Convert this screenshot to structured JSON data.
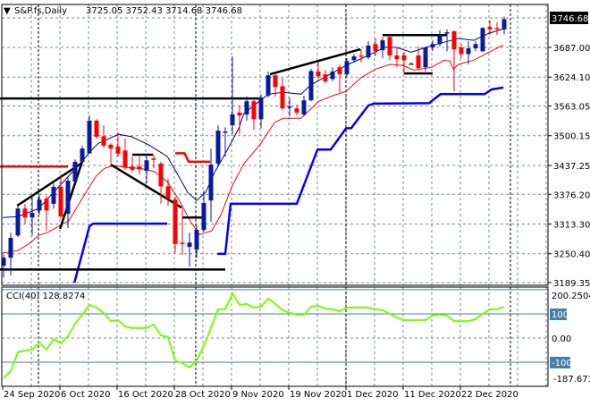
{
  "header": {
    "menu_glyph": "▼",
    "symbol": "S&P.fs,Daily",
    "ohlc": "3725.05 3752.43 3714.68 3746.68"
  },
  "price_axis": {
    "current_price": "3746.68",
    "ticks": [
      "3687.00",
      "3624.10",
      "3563.05",
      "3500.15",
      "3437.25",
      "3376.20",
      "3313.30",
      "3250.40",
      "3189.35"
    ]
  },
  "cci_panel": {
    "title": "CCI(40) 128.8274",
    "max_label": "200.2504",
    "level_up": "100",
    "zero": "0.00",
    "level_down": "-100",
    "min_label": "-187.6739"
  },
  "date_labels": [
    {
      "label": "24 Sep 2020",
      "index": 0
    },
    {
      "label": "6 Oct 2020",
      "index": 8
    },
    {
      "label": "16 Oct 2020",
      "index": 16
    },
    {
      "label": "28 Oct 2020",
      "index": 24
    },
    {
      "label": "9 Nov 2020",
      "index": 32
    },
    {
      "label": "19 Nov 2020",
      "index": 40
    },
    {
      "label": "1 Dec 2020",
      "index": 48
    },
    {
      "label": "11 Dec 2020",
      "index": 56
    },
    {
      "label": "22 Dec 2020",
      "index": 64
    }
  ],
  "colors": {
    "bull": "#0a1a9c",
    "bear": "#ff0000",
    "ma_fast": "#000080",
    "ma_slow": "#ff0000",
    "support": "#0000ff",
    "resistance": "#ff0000",
    "trendlines": "#000000",
    "cci": "#7cfc00",
    "cci_levels": "#4a7eaa"
  },
  "chart_data": {
    "type": "candlestick",
    "title": "S&P.fs,Daily",
    "ylim": [
      3185.6,
      3776
    ],
    "ohlc": [
      [
        3225,
        3248,
        3200,
        3242
      ],
      [
        3242,
        3295,
        3204,
        3284
      ],
      [
        3289,
        3352,
        3286,
        3346
      ],
      [
        3346,
        3356,
        3314,
        3327
      ],
      [
        3327,
        3371,
        3289,
        3337
      ],
      [
        3342,
        3375,
        3333,
        3365
      ],
      [
        3367,
        3373,
        3299,
        3342
      ],
      [
        3356,
        3399,
        3346,
        3392
      ],
      [
        3392,
        3418,
        3325,
        3329
      ],
      [
        3335,
        3412,
        3305,
        3405
      ],
      [
        3403,
        3450,
        3399,
        3445
      ],
      [
        3445,
        3479,
        3441,
        3473
      ],
      [
        3463,
        3543,
        3462,
        3532
      ],
      [
        3532,
        3535,
        3494,
        3498
      ],
      [
        3499,
        3522,
        3475,
        3479
      ],
      [
        3481,
        3484,
        3441,
        3473
      ],
      [
        3477,
        3507,
        3456,
        3462
      ],
      [
        3469,
        3494,
        3428,
        3433
      ],
      [
        3435,
        3456,
        3422,
        3428
      ],
      [
        3435,
        3456,
        3418,
        3429
      ],
      [
        3426,
        3456,
        3399,
        3448
      ],
      [
        3452,
        3460,
        3431,
        3450
      ],
      [
        3441,
        3445,
        3356,
        3393
      ],
      [
        3393,
        3409,
        3352,
        3367
      ],
      [
        3365,
        3371,
        3253,
        3271
      ],
      [
        3274,
        3346,
        3248,
        3272
      ],
      [
        3265,
        3295,
        3223,
        3274
      ],
      [
        3259,
        3310,
        3242,
        3301
      ],
      [
        3301,
        3384,
        3297,
        3358
      ],
      [
        3363,
        3473,
        3318,
        3439
      ],
      [
        3441,
        3522,
        3437,
        3511
      ],
      [
        3507,
        3518,
        3456,
        3509
      ],
      [
        3522,
        3668,
        3503,
        3545
      ],
      [
        3549,
        3564,
        3503,
        3543
      ],
      [
        3545,
        3583,
        3532,
        3573
      ],
      [
        3573,
        3579,
        3513,
        3535
      ],
      [
        3535,
        3588,
        3516,
        3581
      ],
      [
        3585,
        3636,
        3581,
        3628
      ],
      [
        3628,
        3632,
        3583,
        3603
      ],
      [
        3605,
        3622,
        3554,
        3558
      ],
      [
        3560,
        3581,
        3541,
        3562
      ],
      [
        3558,
        3566,
        3543,
        3549
      ],
      [
        3545,
        3585,
        3541,
        3575
      ],
      [
        3575,
        3641,
        3573,
        3637
      ],
      [
        3636,
        3656,
        3620,
        3626
      ],
      [
        3630,
        3639,
        3611,
        3615
      ],
      [
        3620,
        3645,
        3615,
        3636
      ],
      [
        3645,
        3651,
        3592,
        3630
      ],
      [
        3630,
        3664,
        3626,
        3658
      ],
      [
        3660,
        3673,
        3655,
        3668
      ],
      [
        3670,
        3683,
        3655,
        3668
      ],
      [
        3666,
        3700,
        3662,
        3691
      ],
      [
        3694,
        3706,
        3668,
        3679
      ],
      [
        3681,
        3708,
        3664,
        3702
      ],
      [
        3709,
        3713,
        3660,
        3670
      ],
      [
        3670,
        3687,
        3645,
        3662
      ],
      [
        3670,
        3677,
        3630,
        3660
      ],
      [
        3653,
        3655,
        3651,
        3653
      ],
      [
        3670,
        3689,
        3639,
        3643
      ],
      [
        3645,
        3689,
        3636,
        3687
      ],
      [
        3687,
        3702,
        3679,
        3694
      ],
      [
        3694,
        3723,
        3689,
        3713
      ],
      [
        3717,
        3725,
        3679,
        3719
      ],
      [
        3721,
        3723,
        3594,
        3683
      ],
      [
        3687,
        3694,
        3664,
        3673
      ],
      [
        3673,
        3700,
        3651,
        3685
      ],
      [
        3685,
        3700,
        3679,
        3694
      ],
      [
        3679,
        3730,
        3677,
        3728
      ],
      [
        3730,
        3745,
        3713,
        3725
      ],
      [
        3728,
        3740,
        3713,
        3726
      ],
      [
        3725.05,
        3752.43,
        3714.68,
        3746.68
      ]
    ],
    "ma_fast": [
      [
        -0.1,
        3327
      ],
      [
        2,
        3329
      ],
      [
        4.9,
        3346
      ],
      [
        11,
        3446
      ],
      [
        12,
        3465
      ],
      [
        13.25,
        3484
      ],
      [
        16.1,
        3503
      ],
      [
        17.9,
        3498
      ],
      [
        20.4,
        3480
      ],
      [
        22.9,
        3456
      ],
      [
        24.5,
        3414
      ],
      [
        25.75,
        3380
      ],
      [
        27,
        3363
      ],
      [
        28.25,
        3380
      ],
      [
        29.5,
        3422
      ],
      [
        31.1,
        3465
      ],
      [
        32.9,
        3516
      ],
      [
        33.6,
        3547
      ],
      [
        37,
        3588
      ],
      [
        39.1,
        3592
      ],
      [
        41.6,
        3588
      ],
      [
        42.9,
        3607
      ],
      [
        44.9,
        3624
      ],
      [
        47.9,
        3649
      ],
      [
        50.75,
        3668
      ],
      [
        53.25,
        3687
      ],
      [
        54.9,
        3687
      ],
      [
        57,
        3677
      ],
      [
        59.1,
        3687
      ],
      [
        61.6,
        3698
      ],
      [
        63.6,
        3706
      ],
      [
        65.75,
        3702
      ],
      [
        67.9,
        3717
      ],
      [
        69.9,
        3726
      ]
    ],
    "ma_slow": [
      [
        -0.1,
        3252
      ],
      [
        2,
        3257
      ],
      [
        3.6,
        3272
      ],
      [
        4.9,
        3289
      ],
      [
        6.1,
        3295
      ],
      [
        7.9,
        3310
      ],
      [
        9.1,
        3320
      ],
      [
        10.75,
        3361
      ],
      [
        12.9,
        3414
      ],
      [
        14.1,
        3431
      ],
      [
        15.4,
        3437
      ],
      [
        17,
        3433
      ],
      [
        19.1,
        3431
      ],
      [
        21.1,
        3424
      ],
      [
        22.9,
        3403
      ],
      [
        24.5,
        3365
      ],
      [
        26.1,
        3320
      ],
      [
        27.4,
        3291
      ],
      [
        29.1,
        3299
      ],
      [
        30.4,
        3333
      ],
      [
        32,
        3395
      ],
      [
        33.6,
        3441
      ],
      [
        35.75,
        3479
      ],
      [
        37.9,
        3528
      ],
      [
        39.1,
        3537
      ],
      [
        41.6,
        3537
      ],
      [
        44.1,
        3573
      ],
      [
        46.1,
        3585
      ],
      [
        47.9,
        3594
      ],
      [
        49.9,
        3622
      ],
      [
        52,
        3641
      ],
      [
        54.1,
        3651
      ],
      [
        55.75,
        3649
      ],
      [
        57.4,
        3639
      ],
      [
        59.9,
        3645
      ],
      [
        61.6,
        3660
      ],
      [
        62.4,
        3658
      ],
      [
        62.9,
        3641
      ],
      [
        63.6,
        3651
      ],
      [
        65.75,
        3660
      ],
      [
        67.9,
        3677
      ],
      [
        69.9,
        3692
      ]
    ],
    "support_steps": [
      [
        [
          9.9,
          3189
        ],
        [
          12,
          3308
        ],
        [
          12.5,
          3314
        ],
        [
          22.9,
          3314
        ]
      ],
      [
        [
          29.9,
          3250
        ],
        [
          31,
          3250
        ],
        [
          31.75,
          3356
        ],
        [
          41,
          3356
        ],
        [
          43.9,
          3471
        ],
        [
          45.75,
          3471
        ],
        [
          47.9,
          3516
        ],
        [
          48.6,
          3516
        ],
        [
          51,
          3564
        ],
        [
          51.75,
          3568
        ],
        [
          59.5,
          3569
        ],
        [
          61.1,
          3588
        ],
        [
          67.25,
          3588
        ],
        [
          68.25,
          3598
        ],
        [
          69.9,
          3602
        ]
      ]
    ],
    "resistance_steps": [
      [
        [
          -0.5,
          3435
        ],
        [
          9,
          3435
        ]
      ],
      [
        [
          24,
          3463
        ],
        [
          25.3,
          3463
        ],
        [
          25.9,
          3445
        ],
        [
          28.9,
          3445
        ]
      ]
    ],
    "drawn_lines": [
      [
        [
          -0.5,
          3579
        ],
        [
          36,
          3579
        ]
      ],
      [
        [
          -0.5,
          3217
        ],
        [
          31,
          3217
        ]
      ],
      [
        [
          1.9,
          3352
        ],
        [
          11,
          3443
        ]
      ],
      [
        [
          7.9,
          3303
        ],
        [
          11,
          3446
        ]
      ],
      [
        [
          15,
          3439
        ],
        [
          24.9,
          3348
        ]
      ],
      [
        [
          18,
          3460
        ],
        [
          20.9,
          3460
        ]
      ],
      [
        [
          25,
          3327
        ],
        [
          27.9,
          3327
        ]
      ],
      [
        [
          37.25,
          3630
        ],
        [
          49.9,
          3683
        ]
      ],
      [
        [
          53,
          3713
        ],
        [
          62,
          3713
        ]
      ],
      [
        [
          56,
          3632
        ],
        [
          60,
          3632
        ]
      ]
    ],
    "cci": {
      "period": 40,
      "ylim": [
        -187.6739,
        200.2504
      ],
      "levels": [
        100,
        0,
        -100
      ],
      "values": [
        -167,
        -137,
        -59,
        -52,
        -48,
        -19,
        -48,
        -4,
        -22,
        7,
        59,
        96,
        137,
        126,
        104,
        70,
        74,
        48,
        41,
        41,
        41,
        56,
        11,
        4,
        -93,
        -104,
        -122,
        -93,
        -33,
        41,
        119,
        119,
        185,
        137,
        141,
        126,
        130,
        163,
        141,
        115,
        104,
        96,
        96,
        130,
        133,
        122,
        119,
        111,
        126,
        126,
        126,
        126,
        119,
        115,
        100,
        85,
        74,
        74,
        74,
        74,
        93,
        96,
        93,
        70,
        70,
        70,
        78,
        100,
        119,
        119,
        128.8274
      ]
    }
  }
}
